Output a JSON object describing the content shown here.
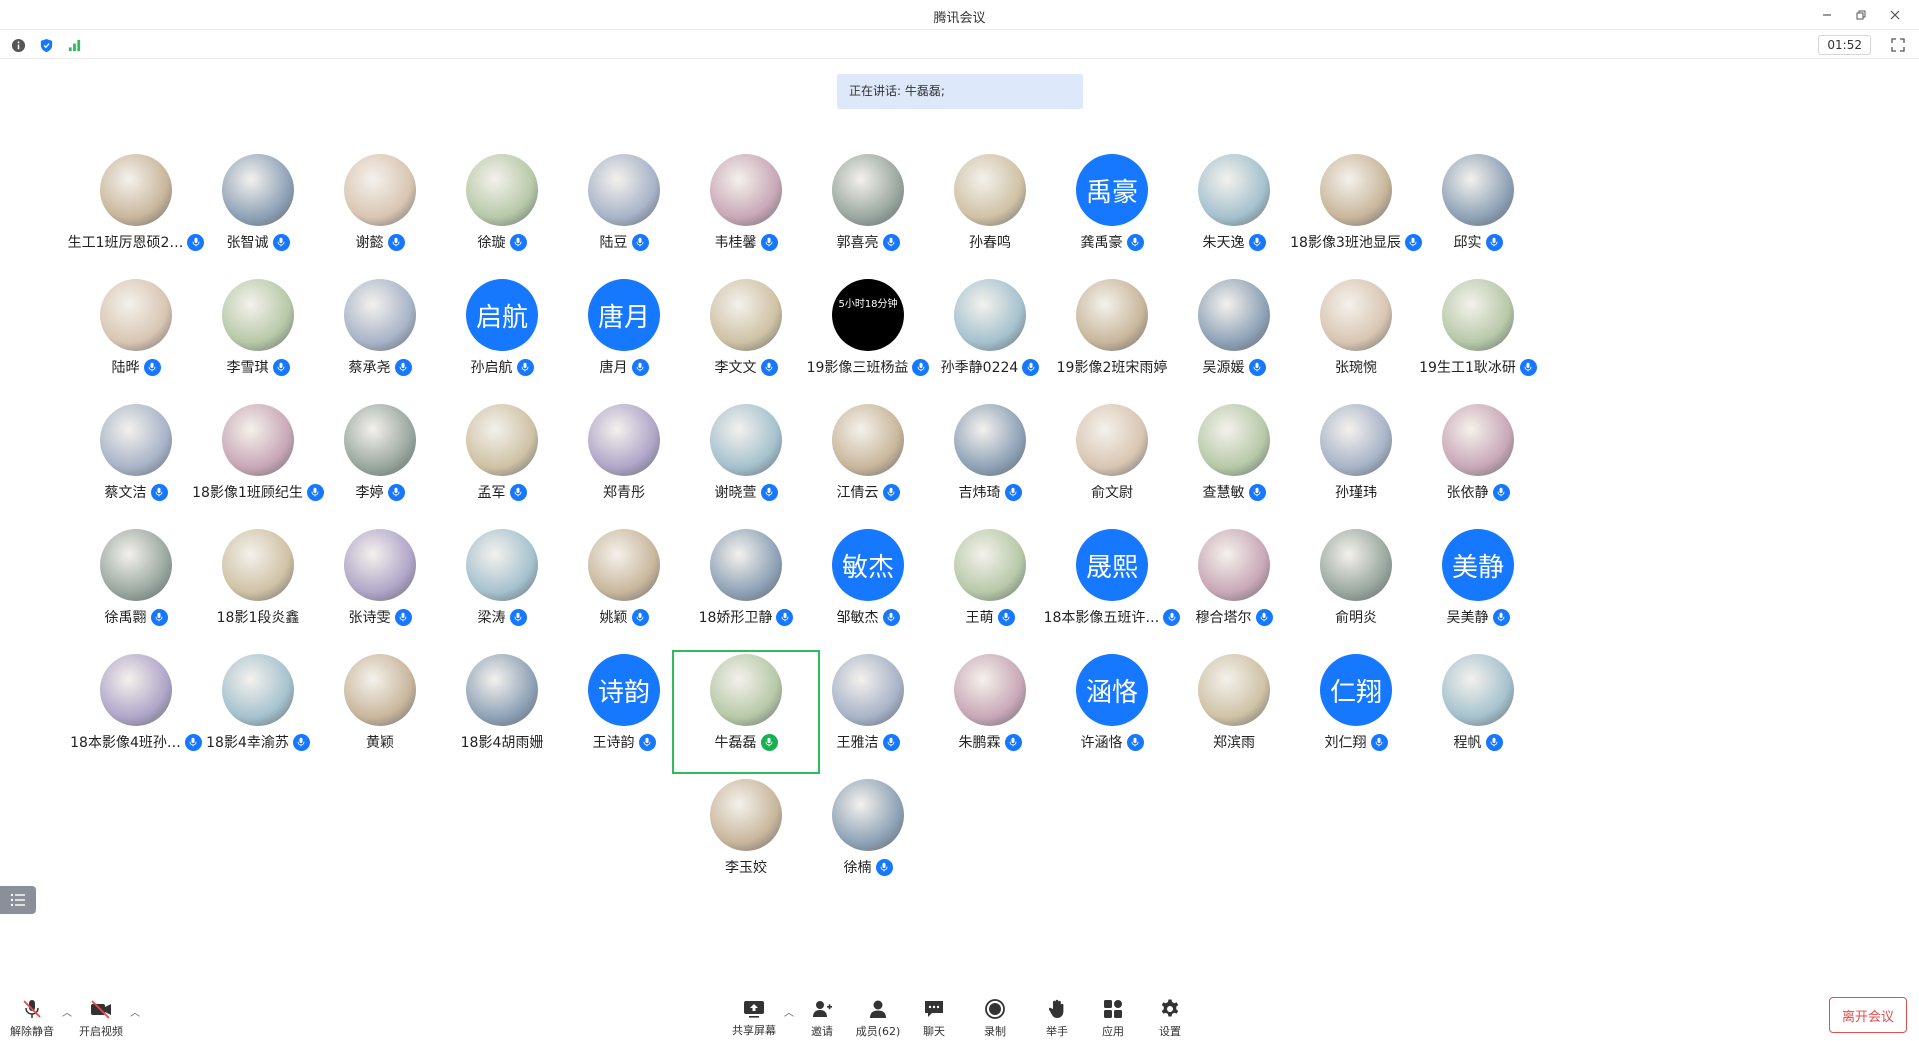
{
  "window": {
    "title": "腾讯会议"
  },
  "infobar": {
    "timer": "01:52"
  },
  "speaking": {
    "text": "正在讲话: 牛磊磊;"
  },
  "colors": {
    "accent": "#1677ff",
    "active_border": "#2ebd5c",
    "leave": "#e34d4d"
  },
  "participants": [
    {
      "name": "生工1班厉恩硕2…",
      "avatar": "photo-doraemon",
      "mic": "on"
    },
    {
      "name": "张智诚",
      "avatar": "photo-anime-boy",
      "mic": "on"
    },
    {
      "name": "谢懿",
      "avatar": "photo-samoyed",
      "mic": "on"
    },
    {
      "name": "徐璇",
      "avatar": "photo-pink-blob",
      "mic": "on"
    },
    {
      "name": "陆豆",
      "avatar": "photo-cartoon-girl",
      "mic": "on"
    },
    {
      "name": "韦桂馨",
      "avatar": "photo-girl",
      "mic": "on"
    },
    {
      "name": "郭喜亮",
      "avatar": "photo-dark",
      "mic": "on"
    },
    {
      "name": "孙春鸣",
      "avatar": "photo-anime-white",
      "mic": "none"
    },
    {
      "name": "龚禹豪",
      "avatar": "text",
      "avatar_text": "禹豪",
      "mic": "on"
    },
    {
      "name": "朱天逸",
      "avatar": "photo-teddy",
      "mic": "on"
    },
    {
      "name": "18影像3班池显辰",
      "avatar": "photo-cartoon-yellow",
      "mic": "on"
    },
    {
      "name": "邱实",
      "avatar": "photo-cat",
      "mic": "on"
    },
    {
      "name": "陆晔",
      "avatar": "photo-cartoon-dark",
      "mic": "on"
    },
    {
      "name": "李雪琪",
      "avatar": "photo-earth",
      "mic": "on"
    },
    {
      "name": "蔡承尧",
      "avatar": "photo-charmander",
      "mic": "on"
    },
    {
      "name": "孙启航",
      "avatar": "text",
      "avatar_text": "启航",
      "mic": "on"
    },
    {
      "name": "唐月",
      "avatar": "text",
      "avatar_text": "唐月",
      "mic": "on"
    },
    {
      "name": "李文文",
      "avatar": "photo-shiba",
      "mic": "on"
    },
    {
      "name": "19影像三班杨益",
      "avatar": "photo-black-text",
      "avatar_text": "5小时18分钟",
      "mic": "on"
    },
    {
      "name": "孙季静0224",
      "avatar": "photo-night",
      "mic": "on"
    },
    {
      "name": "19影像2班宋雨婷",
      "avatar": "photo-cartoon-man",
      "mic": "none"
    },
    {
      "name": "吴源媛",
      "avatar": "photo-patrick",
      "mic": "on"
    },
    {
      "name": "张琬惋",
      "avatar": "photo-man",
      "mic": "none"
    },
    {
      "name": "19生工1耿冰研",
      "avatar": "photo-white-cat",
      "mic": "on"
    },
    {
      "name": "蔡文洁",
      "avatar": "photo-peach",
      "mic": "on"
    },
    {
      "name": "18影像1班顾纪生",
      "avatar": "photo-teal",
      "mic": "on"
    },
    {
      "name": "李婷",
      "avatar": "photo-girl-dark",
      "mic": "on"
    },
    {
      "name": "孟军",
      "avatar": "photo-boy",
      "mic": "on"
    },
    {
      "name": "郑青彤",
      "avatar": "photo-boy-2",
      "mic": "none"
    },
    {
      "name": "谢晓萱",
      "avatar": "photo-cartoon-cyan",
      "mic": "on"
    },
    {
      "name": "江倩云",
      "avatar": "photo-bunny",
      "mic": "on"
    },
    {
      "name": "吉炜琦",
      "avatar": "photo-cat-glasses",
      "mic": "on"
    },
    {
      "name": "俞文尉",
      "avatar": "photo-dog",
      "mic": "none"
    },
    {
      "name": "查慧敏",
      "avatar": "photo-bear",
      "mic": "on"
    },
    {
      "name": "孙瑾玮",
      "avatar": "photo-sketch",
      "mic": "none"
    },
    {
      "name": "张依静",
      "avatar": "photo-girl-hat",
      "mic": "on"
    },
    {
      "name": "徐禹翾",
      "avatar": "photo-girl-flowers",
      "mic": "on"
    },
    {
      "name": "18影1段炎鑫",
      "avatar": "photo-shiba-2",
      "mic": "none"
    },
    {
      "name": "张诗雯",
      "avatar": "photo-meme",
      "mic": "on"
    },
    {
      "name": "梁涛",
      "avatar": "photo-jerry",
      "mic": "on"
    },
    {
      "name": "姚颖",
      "avatar": "photo-lines",
      "mic": "on"
    },
    {
      "name": "18娇形卫静",
      "avatar": "photo-cat-face",
      "mic": "on"
    },
    {
      "name": "邹敏杰",
      "avatar": "text",
      "avatar_text": "敏杰",
      "mic": "on"
    },
    {
      "name": "王萌",
      "avatar": "photo-ghost",
      "mic": "on"
    },
    {
      "name": "18本影像五班许…",
      "avatar": "text",
      "avatar_text": "晟熙",
      "mic": "on"
    },
    {
      "name": "穆合塔尔",
      "avatar": "photo-red",
      "mic": "on"
    },
    {
      "name": "俞明炎",
      "avatar": "photo-castle",
      "mic": "none"
    },
    {
      "name": "吴美静",
      "avatar": "text",
      "avatar_text": "美静",
      "mic": "on"
    },
    {
      "name": "18本影像4班孙…",
      "avatar": "photo-calligraphy",
      "mic": "on"
    },
    {
      "name": "18影4幸渝苏",
      "avatar": "photo-room",
      "mic": "on"
    },
    {
      "name": "黄颖",
      "avatar": "photo-goose",
      "mic": "none"
    },
    {
      "name": "18影4胡雨姗",
      "avatar": "photo-girl-3",
      "mic": "none"
    },
    {
      "name": "王诗韵",
      "avatar": "text",
      "avatar_text": "诗韵",
      "mic": "on"
    },
    {
      "name": "牛磊磊",
      "avatar": "photo-girl-field",
      "mic": "speaking",
      "active": true
    },
    {
      "name": "王雅洁",
      "avatar": "photo-shinchan",
      "mic": "on"
    },
    {
      "name": "朱鹏霖",
      "avatar": "photo-rider",
      "mic": "on"
    },
    {
      "name": "许涵恪",
      "avatar": "text",
      "avatar_text": "涵恪",
      "mic": "on"
    },
    {
      "name": "郑滨雨",
      "avatar": "photo-girl-4",
      "mic": "none"
    },
    {
      "name": "刘仁翔",
      "avatar": "text",
      "avatar_text": "仁翔",
      "mic": "on"
    },
    {
      "name": "程帆",
      "avatar": "photo-moon",
      "mic": "on"
    },
    {
      "name": "李玉姣",
      "avatar": "photo-cartoon-pink",
      "mic": "none"
    },
    {
      "name": "徐楠",
      "avatar": "photo-girl-hat-2",
      "mic": "on"
    }
  ],
  "toolbar": {
    "unmute": "解除静音",
    "start_video": "开启视频",
    "share": "共享屏幕",
    "invite": "邀请",
    "members": "成员(62)",
    "chat": "聊天",
    "record": "录制",
    "raise_hand": "举手",
    "apps": "应用",
    "settings": "设置",
    "leave": "离开会议"
  }
}
